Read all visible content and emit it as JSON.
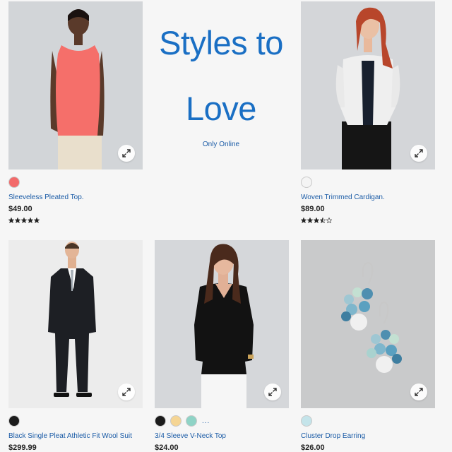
{
  "promo": {
    "line1": "Styles to",
    "line2": "Love",
    "subtitle": "Only Online"
  },
  "products": [
    {
      "name": "Sleeveless Pleated Top.",
      "price": "$49.00",
      "swatches": [
        "#f26a6a"
      ],
      "rating": 5,
      "rating_max": 5,
      "more": ""
    },
    {
      "name": "Woven Trimmed Cardigan.",
      "price": "$89.00",
      "swatches": [
        "#f4f4f4"
      ],
      "rating": 3.5,
      "rating_max": 5,
      "more": ""
    },
    {
      "name": "Black Single Pleat Athletic Fit Wool Suit",
      "price": "$299.99",
      "swatches": [
        "#1c1c1c"
      ],
      "rating": null,
      "rating_max": 5,
      "more": ""
    },
    {
      "name": "3/4 Sleeve V-Neck Top",
      "price": "$24.00",
      "swatches": [
        "#1c1c1c",
        "#f5d594",
        "#8fd3c6"
      ],
      "rating": null,
      "rating_max": 5,
      "more": "..."
    },
    {
      "name": "Cluster Drop Earring",
      "price": "$26.00",
      "swatches": [
        "#c4e4ea"
      ],
      "rating": null,
      "rating_max": 5,
      "more": ""
    }
  ],
  "icons": {
    "expand": "expand-arrows-icon",
    "star": "star-icon"
  },
  "colors": {
    "link": "#1a5ba6",
    "promo": "#1a6fc4",
    "background": "#f6f6f6"
  }
}
